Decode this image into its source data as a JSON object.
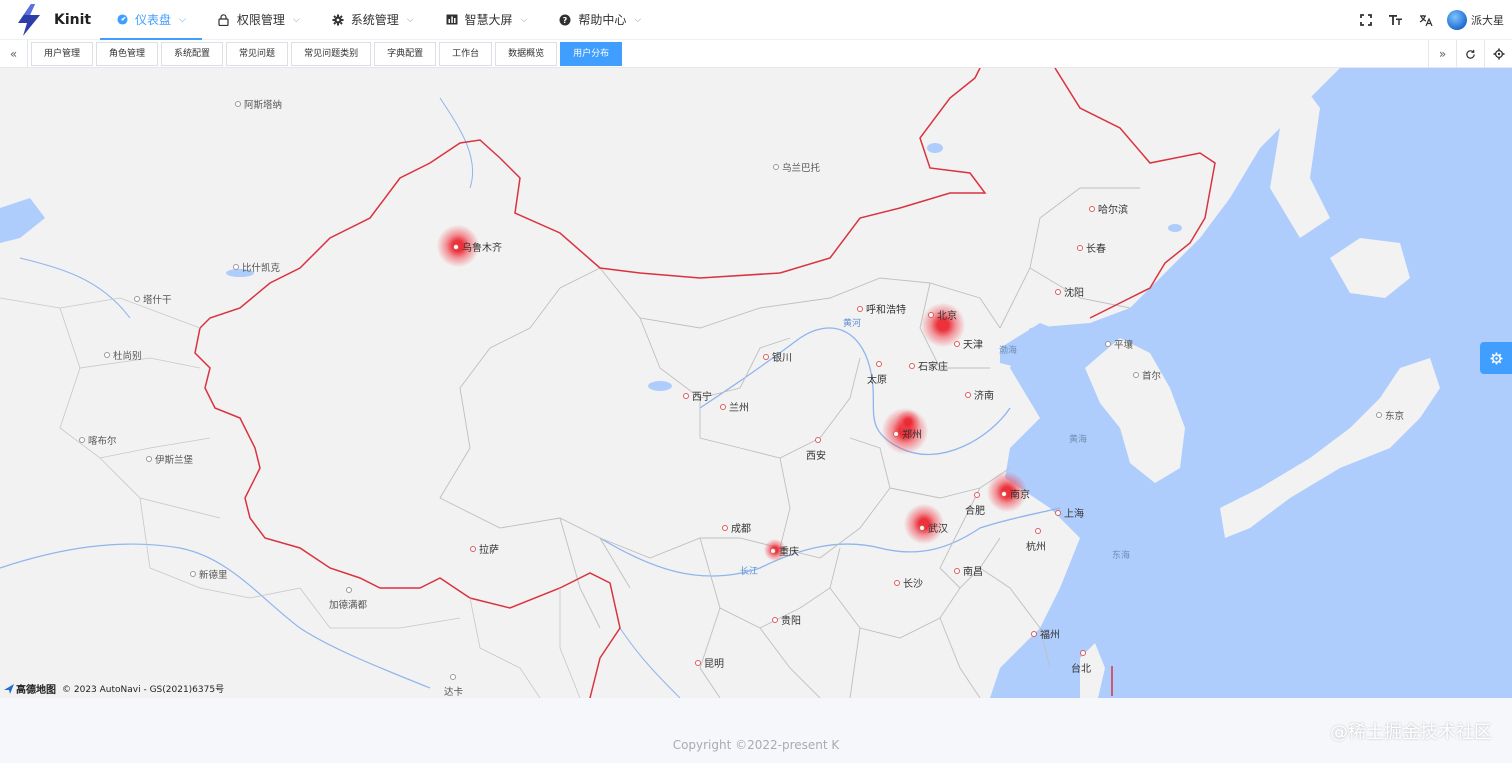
{
  "app": {
    "title": "Kinit"
  },
  "nav": [
    {
      "label": "仪表盘",
      "icon": "dashboard-icon",
      "active": true
    },
    {
      "label": "权限管理",
      "icon": "lock-icon",
      "active": false
    },
    {
      "label": "系统管理",
      "icon": "gear-icon",
      "active": false
    },
    {
      "label": "智慧大屏",
      "icon": "chart-icon",
      "active": false
    },
    {
      "label": "帮助中心",
      "icon": "help-icon",
      "active": false
    }
  ],
  "tools": {
    "fullscreen": "fullscreen-icon",
    "font_size": "font-size-icon",
    "language": "language-icon"
  },
  "user": {
    "name": "派大星"
  },
  "tabs": [
    "用户管理",
    "角色管理",
    "系统配置",
    "常见问题",
    "常见问题类别",
    "字典配置",
    "工作台",
    "数据概览",
    "用户分布"
  ],
  "active_tab": "用户分布",
  "map": {
    "cities": {
      "wulumuqi": "乌鲁木齐",
      "beijing": "北京",
      "tianjin": "天津",
      "zhengzhou": "郑州",
      "nanjing": "南京",
      "wuhan": "武汉",
      "chongqing": "重庆",
      "haerbin": "哈尔滨",
      "changchun": "长春",
      "shenyang": "沈阳",
      "huhehaote": "呼和浩特",
      "yinchuan": "银川",
      "shijiazhuang": "石家庄",
      "taiyuan": "太原",
      "jinan": "济南",
      "xining": "西宁",
      "lanzhou": "兰州",
      "xian": "西安",
      "hefei": "合肥",
      "shanghai": "上海",
      "chengdu": "成都",
      "hangzhou": "杭州",
      "lasa": "拉萨",
      "changsha": "长沙",
      "nanchang": "南昌",
      "guiyang": "贵阳",
      "fuzhou": "福州",
      "kunming": "昆明",
      "taibei": "台北"
    },
    "foreign": {
      "astana": "阿斯塔纳",
      "ulaanbaatar": "乌兰巴托",
      "bishkek": "比什凯克",
      "tashkent": "塔什干",
      "dushanbe": "杜尚别",
      "kabul": "喀布尔",
      "islamabad": "伊斯兰堡",
      "newdelhi": "新德里",
      "kathmandu": "加德满都",
      "dhaka": "达卡",
      "pyongyang": "平壤",
      "seoul": "首尔",
      "tokyo": "东京"
    },
    "seas": {
      "bohai": "渤海",
      "huanghai": "黄海",
      "donghai": "东海"
    },
    "rivers": {
      "huanghe": "黄河",
      "changjiang": "长江"
    },
    "attribution": "© 2023 AutoNavi - GS(2021)6375号",
    "provider": "高德地图"
  },
  "footer": {
    "copyright": "Copyright ©2022-present K"
  },
  "watermark": "@稀土掘金技术社区"
}
